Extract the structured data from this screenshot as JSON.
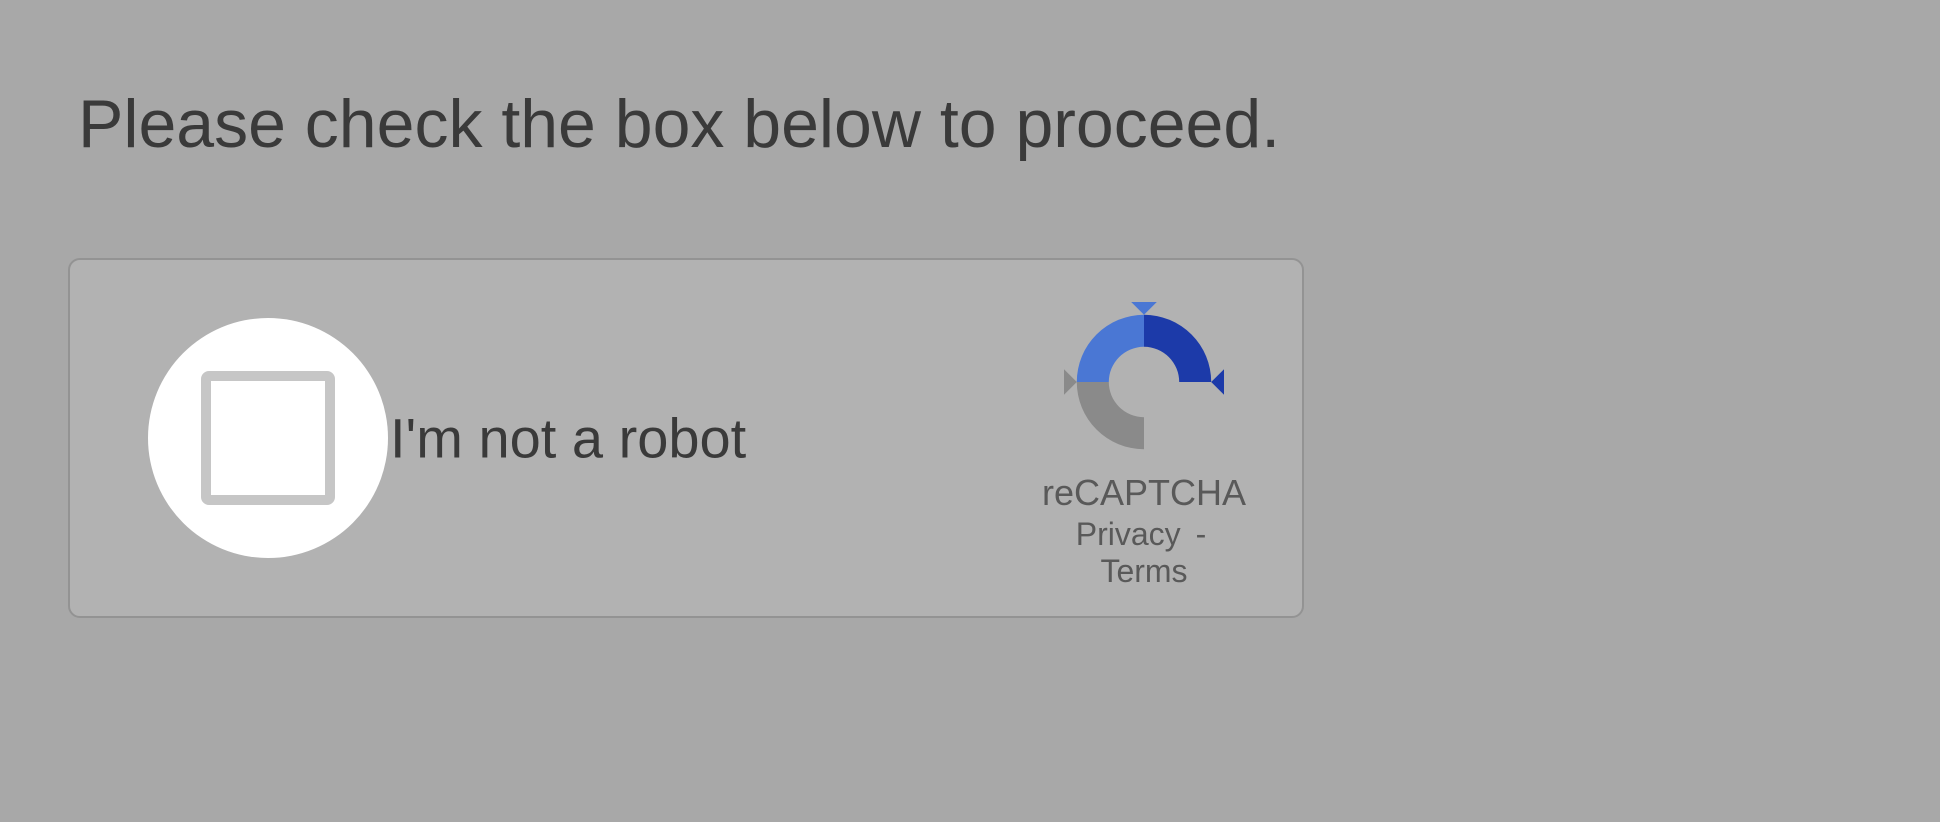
{
  "instruction": "Please check the box below to proceed.",
  "captcha": {
    "label": "I'm not a robot",
    "brand": "reCAPTCHA",
    "privacy": "Privacy",
    "separator": "-",
    "terms": "Terms"
  }
}
